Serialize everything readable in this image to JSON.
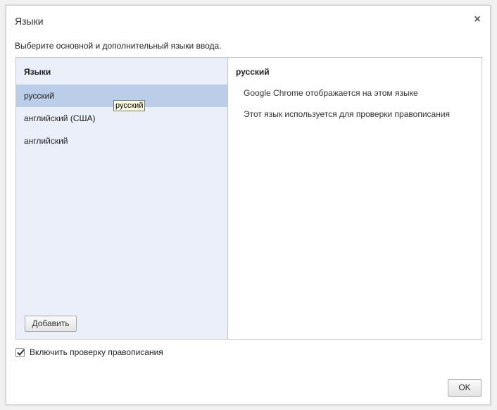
{
  "dialog": {
    "title": "Языки",
    "description": "Выберите основной и дополнительный языки ввода.",
    "close_icon": "close-icon"
  },
  "languages": {
    "header": "Языки",
    "items": [
      "русский",
      "английский (США)",
      "английский"
    ],
    "selected": "русский",
    "tooltip": "русский",
    "add_label": "Добавить"
  },
  "details": {
    "title": "русский",
    "line1": "Google Chrome отображается на этом языке",
    "line2": "Этот язык используется для проверки правописания"
  },
  "spellcheck": {
    "label": "Включить проверку правописания",
    "checked": true
  },
  "footer": {
    "ok_label": "OK"
  },
  "colors": {
    "selected_bg": "#bbcee9",
    "list_bg": "#ebeff9",
    "tooltip_bg": "#ffffe1"
  }
}
